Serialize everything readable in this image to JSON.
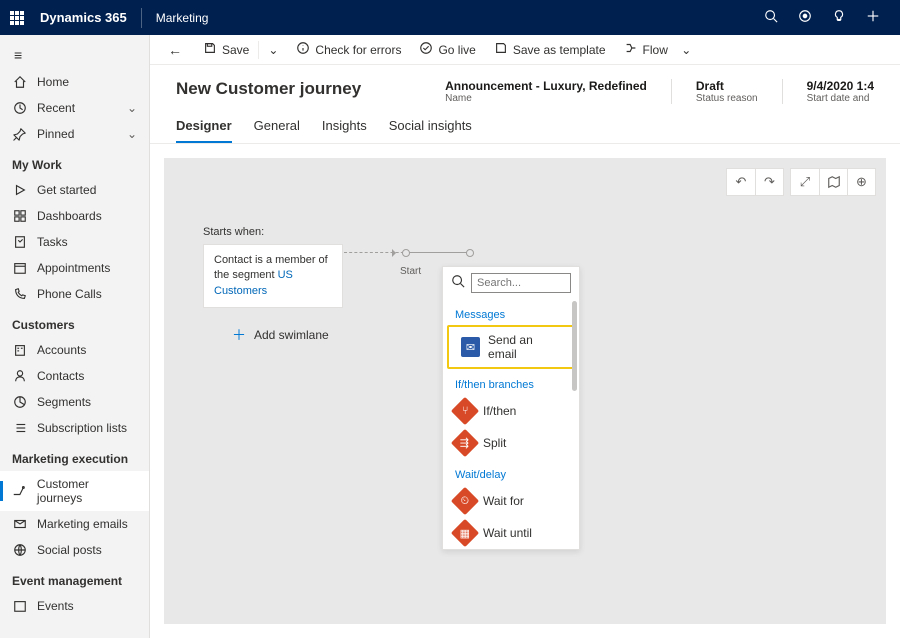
{
  "topbar": {
    "brand": "Dynamics 365",
    "app": "Marketing"
  },
  "commands": {
    "save": "Save",
    "check": "Check for errors",
    "golive": "Go live",
    "savetpl": "Save as template",
    "flow": "Flow"
  },
  "nav": {
    "home": "Home",
    "recent": "Recent",
    "pinned": "Pinned",
    "mywork_head": "My Work",
    "getstarted": "Get started",
    "dashboards": "Dashboards",
    "tasks": "Tasks",
    "appointments": "Appointments",
    "phonecalls": "Phone Calls",
    "customers_head": "Customers",
    "accounts": "Accounts",
    "contacts": "Contacts",
    "segments": "Segments",
    "sublists": "Subscription lists",
    "mktexec_head": "Marketing execution",
    "journeys": "Customer journeys",
    "emails": "Marketing emails",
    "social": "Social posts",
    "eventmgmt_head": "Event management",
    "events": "Events"
  },
  "header": {
    "title": "New Customer journey",
    "name_val": "Announcement - Luxury, Redefined",
    "name_lbl": "Name",
    "status_val": "Draft",
    "status_lbl": "Status reason",
    "date_val": "9/4/2020 1:4",
    "date_lbl": "Start date and"
  },
  "tabs": {
    "designer": "Designer",
    "general": "General",
    "insights": "Insights",
    "social": "Social insights"
  },
  "canvas": {
    "startswhen": "Starts when:",
    "condition_pre": "Contact is a member of the segment ",
    "condition_link": "US Customers",
    "startnode": "Start",
    "addswim": "Add swimlane"
  },
  "popup": {
    "search_ph": "Search...",
    "sec_messages": "Messages",
    "opt_email": "Send an email",
    "sec_branches": "If/then branches",
    "opt_ifthen": "If/then",
    "opt_split": "Split",
    "sec_wait": "Wait/delay",
    "opt_waitfor": "Wait for",
    "opt_waituntil": "Wait until"
  }
}
